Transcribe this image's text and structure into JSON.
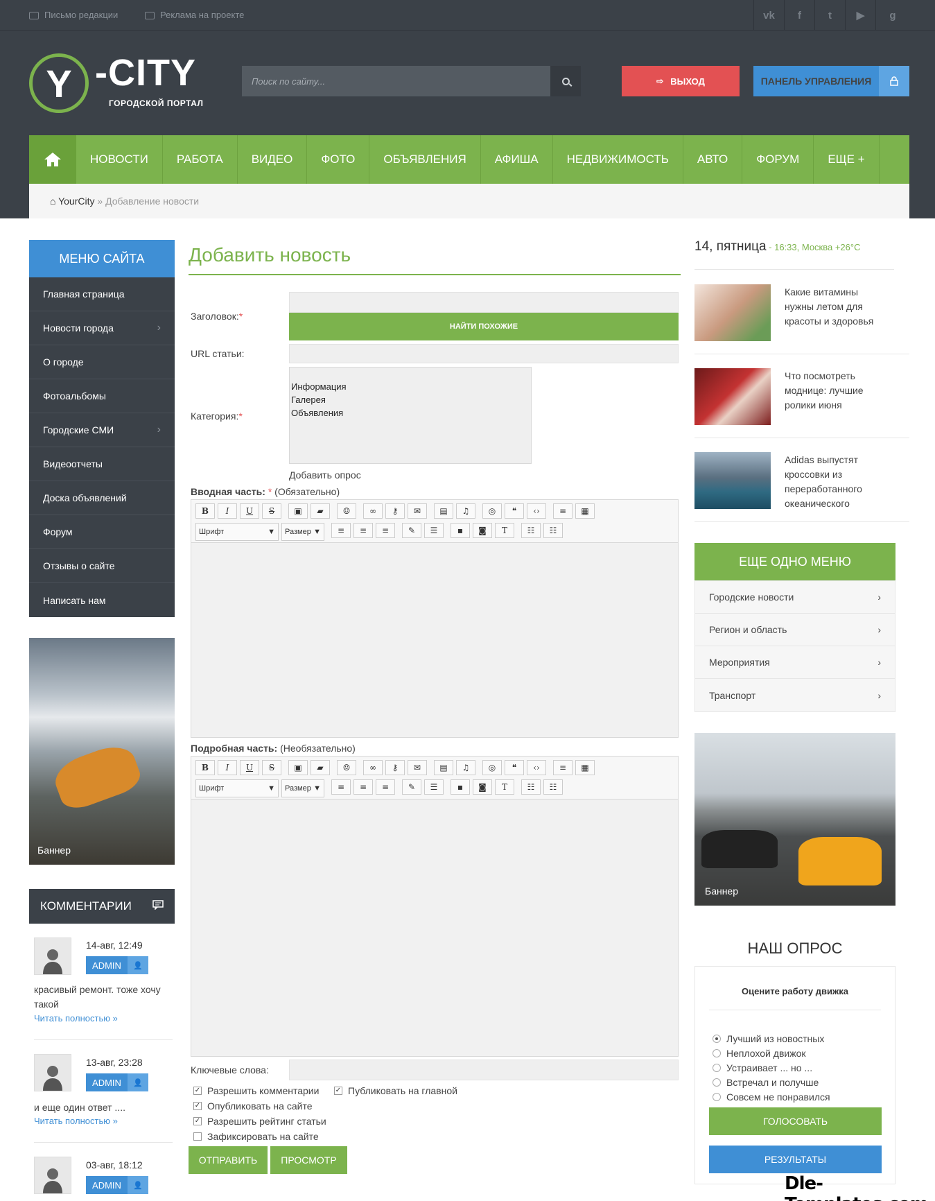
{
  "topbar": {
    "links": [
      "Письмо редакции",
      "Реклама на проекте"
    ],
    "social_icons": [
      "vk-icon",
      "facebook-icon",
      "twitter-icon",
      "youtube-icon",
      "google-plus-icon"
    ]
  },
  "logo": {
    "mark": "Y",
    "name": "-CITY",
    "subtitle": "ГОРОДСКОЙ ПОРТАЛ"
  },
  "search": {
    "placeholder": "Поиск по сайту..."
  },
  "header_buttons": {
    "logout": "ВЫХОД",
    "panel": "ПАНЕЛЬ УПРАВЛЕНИЯ"
  },
  "nav": [
    "НОВОСТИ",
    "РАБОТА",
    "ВИДЕО",
    "ФОТО",
    "ОБЪЯВЛЕНИЯ",
    "АФИША",
    "НЕДВИЖИМОСТЬ",
    "АВТО",
    "ФОРУМ",
    "ЕЩЕ +"
  ],
  "breadcrumb": {
    "home": "YourCity",
    "sep": " » ",
    "current": "Добавление новости"
  },
  "sidebar": {
    "title": "МЕНЮ САЙТА",
    "items": [
      {
        "label": "Главная страница",
        "sub": false
      },
      {
        "label": "Новости города",
        "sub": true
      },
      {
        "label": "О городе",
        "sub": false
      },
      {
        "label": "Фотоальбомы",
        "sub": false
      },
      {
        "label": "Городские СМИ",
        "sub": true
      },
      {
        "label": "Видеоотчеты",
        "sub": false
      },
      {
        "label": "Доска объявлений",
        "sub": false
      },
      {
        "label": "Форум",
        "sub": false
      },
      {
        "label": "Отзывы о сайте",
        "sub": false
      },
      {
        "label": "Написать нам",
        "sub": false
      }
    ],
    "banner": "Баннер"
  },
  "comments": {
    "title": "КОММЕНТАРИИ",
    "items": [
      {
        "date": "14-авг, 12:49",
        "user": "ADMIN",
        "text": "красивый ремонт. тоже хочу такой",
        "link": "Читать полностью »"
      },
      {
        "date": "13-авг, 23:28",
        "user": "ADMIN",
        "text": "и еще один ответ ....",
        "link": "Читать полностью »"
      },
      {
        "date": "03-авг, 18:12",
        "user": "ADMIN",
        "text": "",
        "link": ""
      }
    ]
  },
  "form": {
    "title": "Добавить новость",
    "title_label": "Заголовок:",
    "required_mark": "*",
    "find_similar": "НАЙТИ ПОХОЖИЕ",
    "url_label": "URL статьи:",
    "category_label": "Категория:",
    "categories": [
      "Информация",
      "Галерея",
      "Объявления"
    ],
    "add_poll": "Добавить опрос",
    "intro_label": "Вводная часть:",
    "intro_note": "(Обязательно)",
    "full_label": "Подробная часть:",
    "full_note": "(Необязательно)",
    "font_select": "Шрифт",
    "size_select": "Размер",
    "keywords_label": "Ключевые слова:",
    "checks": [
      {
        "label": "Разрешить комментарии",
        "checked": true
      },
      {
        "label": "Публиковать на главной",
        "checked": true
      },
      {
        "label": "Опубликовать на сайте",
        "checked": true
      },
      {
        "label": "Разрешить рейтинг статьи",
        "checked": true
      },
      {
        "label": "Зафиксировать на сайте",
        "checked": false
      }
    ],
    "submit": "ОТПРАВИТЬ",
    "preview": "ПРОСМОТР"
  },
  "right": {
    "date": "14, пятница",
    "date_extra": " - 16:33, Москва +26°C",
    "news": [
      {
        "title": "Какие витамины нужны летом для красоты и здоровья"
      },
      {
        "title": "Что посмотреть моднице: лучшие ролики июня"
      },
      {
        "title": "Adidas выпустят кроссовки из переработанного океанического"
      }
    ],
    "menu_title": "ЕЩЕ ОДНО МЕНЮ",
    "menu": [
      "Городские новости",
      "Регион и область",
      "Мероприятия",
      "Транспорт"
    ],
    "banner": "Баннер",
    "poll_title": "НАШ ОПРОС",
    "poll_question": "Оцените работу движка",
    "poll_options": [
      "Лучший из новостных",
      "Неплохой движок",
      "Устраивает ... но ...",
      "Встречал и получше",
      "Совсем не понравился"
    ],
    "vote": "ГОЛОСОВАТЬ",
    "results": "РЕЗУЛЬТАТЫ"
  },
  "watermark": "Dle-Templates.com",
  "colors": {
    "green": "#7cb34d",
    "blue": "#3f8fd5",
    "dark": "#3b4148",
    "red": "#e35153"
  }
}
